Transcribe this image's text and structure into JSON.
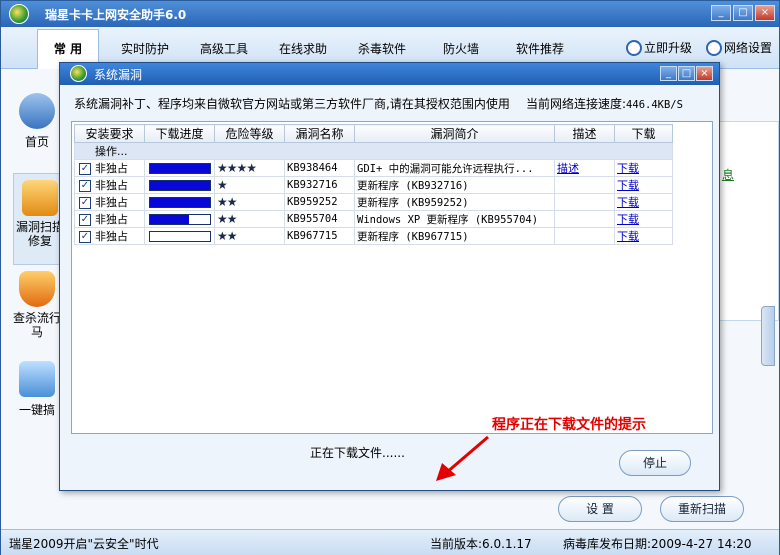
{
  "app": {
    "title": "瑞星卡卡上网安全助手6.0",
    "window_buttons": [
      "_",
      "□",
      "×"
    ]
  },
  "menubar": {
    "items": [
      "常 用",
      "实时防护",
      "高级工具",
      "在线求助",
      "杀毒软件",
      "防火墙",
      "软件推荐"
    ],
    "upgrade": "立即升级",
    "network_settings": "网络设置"
  },
  "sidebar": {
    "items": [
      "首页",
      "漏洞扫描\n修复",
      "查杀流行\n马",
      "一键搞"
    ]
  },
  "background_partial_text": "息",
  "dialog": {
    "title": "系统漏洞",
    "info": "系统漏洞补丁、程序均来自微软官方网站或第三方软件厂商,请在其授权范围内使用",
    "speed_label": "当前网络连接速度:",
    "speed_value": "446.4KB/S",
    "columns": [
      "安装要求",
      "下载进度",
      "危险等级",
      "漏洞名称",
      "漏洞简介",
      "描述",
      "下载"
    ],
    "op_row_label": "操作...",
    "rows": [
      {
        "checked": true,
        "req": "非独占",
        "progress": 1.0,
        "stars": "★★★★",
        "name": "KB938464",
        "desc": "GDI+ 中的漏洞可能允许远程执行...",
        "describe": "描述",
        "download": "下载"
      },
      {
        "checked": true,
        "req": "非独占",
        "progress": 1.0,
        "stars": "★",
        "name": "KB932716",
        "desc": "更新程序 (KB932716)",
        "describe": "",
        "download": "下载"
      },
      {
        "checked": true,
        "req": "非独占",
        "progress": 1.0,
        "stars": "★★",
        "name": "KB959252",
        "desc": "更新程序 (KB959252)",
        "describe": "",
        "download": "下载"
      },
      {
        "checked": true,
        "req": "非独占",
        "progress": 0.65,
        "stars": "★★",
        "name": "KB955704",
        "desc": "Windows XP 更新程序 (KB955704)",
        "describe": "",
        "download": "下载"
      },
      {
        "checked": true,
        "req": "非独占",
        "progress": 0.0,
        "stars": "★★",
        "name": "KB967715",
        "desc": "更新程序 (KB967715)",
        "describe": "",
        "download": "下载"
      }
    ],
    "annotation": "程序正在下载文件的提示",
    "status": "正在下载文件......",
    "stop_button": "停止"
  },
  "footer": {
    "settings_button": "设 置",
    "rescan_button": "重新扫描",
    "slogan": "瑞星2009开启\"云安全\"时代",
    "version_label": "当前版本:6.0.1.17",
    "db_date_label": "病毒库发布日期:2009-4-27 14:20"
  },
  "colors": {
    "title_blue": "#2b66b8",
    "progress_blue": "#0707d8",
    "annotation_red": "#e30000"
  }
}
